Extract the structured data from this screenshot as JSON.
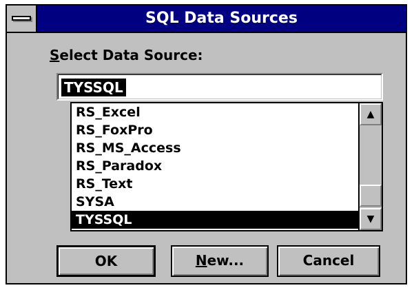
{
  "window": {
    "title": "SQL Data Sources"
  },
  "label": {
    "accel": "S",
    "rest": "elect Data Source:"
  },
  "combo": {
    "value": "TYSSQL"
  },
  "list": {
    "items": [
      "RS_Excel",
      "RS_FoxPro",
      "RS_MS_Access",
      "RS_Paradox",
      "RS_Text",
      "SYSA",
      "TYSSQL"
    ],
    "selected_index": 6
  },
  "buttons": {
    "ok": "OK",
    "new_accel": "N",
    "new_rest": "ew...",
    "cancel": "Cancel"
  },
  "icons": {
    "system_menu": "system-menu-icon",
    "scroll_up": "scroll-up-arrow-icon",
    "scroll_down": "scroll-down-arrow-icon"
  }
}
